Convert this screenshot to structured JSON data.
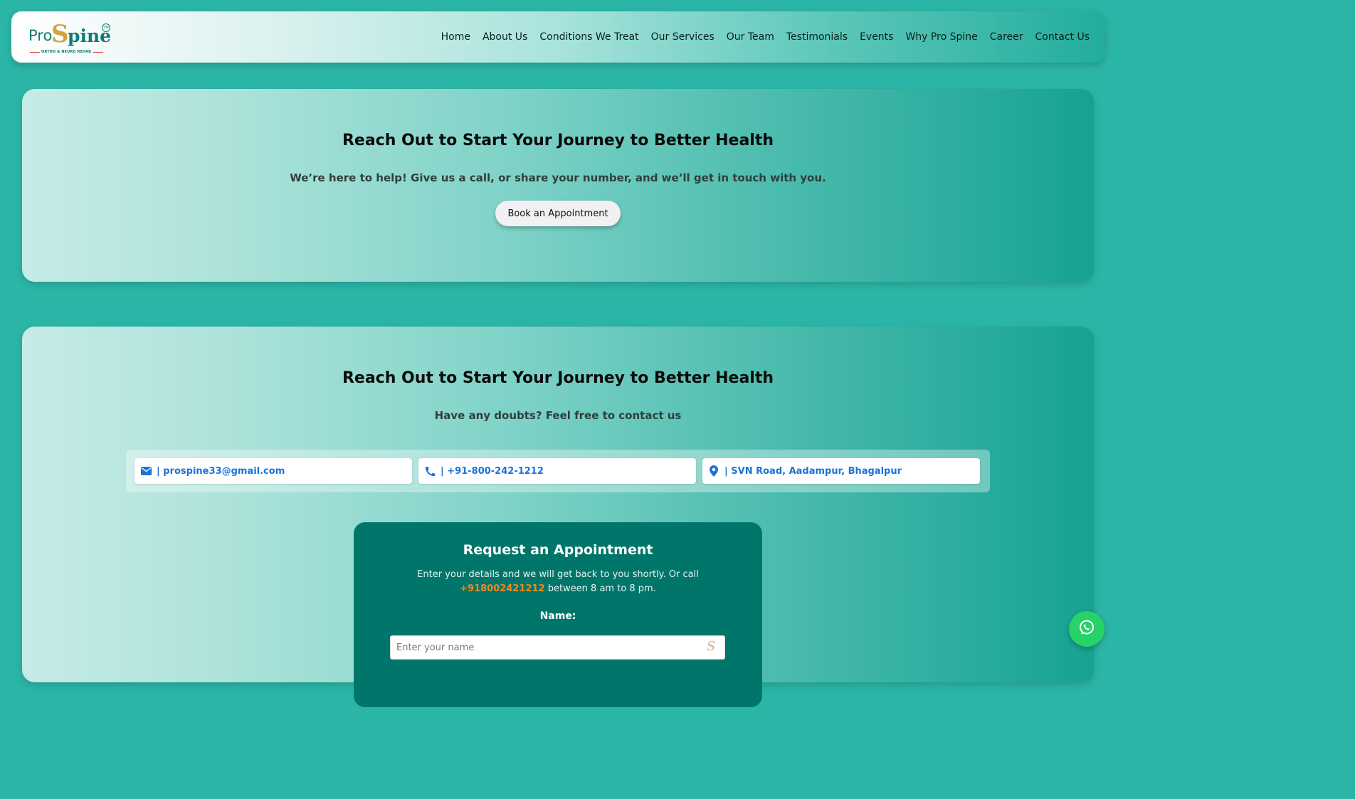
{
  "brand": {
    "logo_pro": "Pro",
    "logo_s": "S",
    "logo_pine": "pine",
    "logo_tm": "TM",
    "logo_tagline": "ORTHO & NEURO REHAB"
  },
  "nav": {
    "items": [
      "Home",
      "About Us",
      "Conditions We Treat",
      "Our Services",
      "Our Team",
      "Testimonials",
      "Events",
      "Why Pro Spine",
      "Career",
      "Contact Us"
    ]
  },
  "hero": {
    "heading": "Reach Out to Start Your Journey to Better Health",
    "subtext": "We’re here to help! Give us a call, or share your number, and we’ll get in touch with you.",
    "button_label": "Book an Appointment"
  },
  "contact": {
    "heading": "Reach Out to Start Your Journey to Better Health",
    "subtext": "Have any doubts? Feel free to contact us",
    "email": "| prospine33@gmail.com",
    "phone": "| +91-800-242-1212",
    "address": "| SVN Road, Aadampur, Bhagalpur",
    "icon_color": "#1a73d9"
  },
  "form": {
    "title": "Request an Appointment",
    "desc_before": "Enter your details and we will get back to you shortly. Or call ",
    "desc_phone": "+918002421212",
    "desc_after": " between 8 am to 8 pm.",
    "name_label": "Name:",
    "name_placeholder": "Enter your name"
  },
  "colors": {
    "page_bg": "#2bb5a6",
    "form_bg": "#00766b",
    "phone_highlight": "#f08a1c",
    "whatsapp": "#25d366"
  },
  "icons": {
    "email": "envelope-icon",
    "phone": "phone-icon",
    "address": "map-pin-icon",
    "chat": "whatsapp-icon"
  }
}
